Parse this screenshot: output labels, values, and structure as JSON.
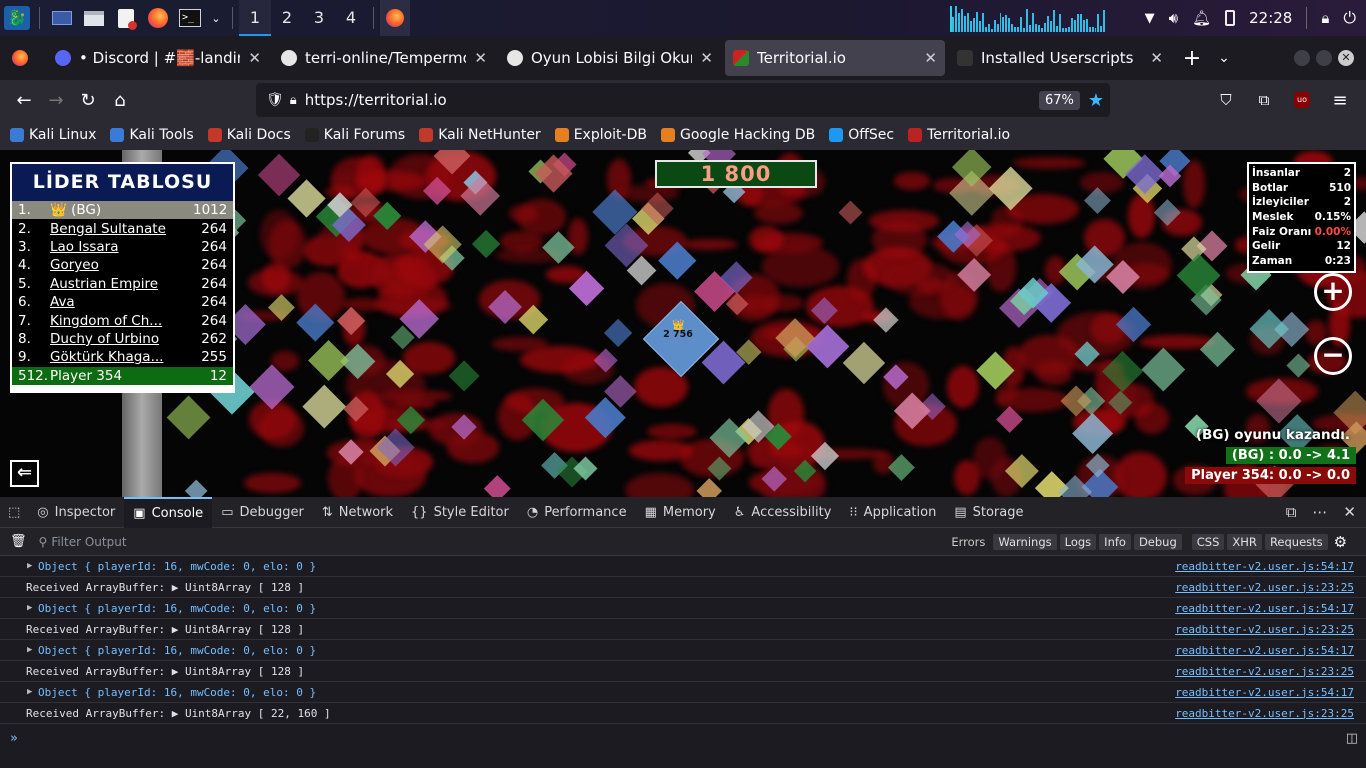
{
  "taskbar": {
    "workspaces": [
      "1",
      "2",
      "3",
      "4"
    ],
    "clock": "22:28"
  },
  "tabs": [
    {
      "title": "• Discord | #🧱-landing-zc",
      "fav": "#5865f2"
    },
    {
      "title": "terri-online/Tempermonk",
      "fav": "#e6e6e6"
    },
    {
      "title": "Oyun Lobisi Bilgi Okuma",
      "fav": "#e6e6e6"
    },
    {
      "title": "Territorial.io",
      "fav": "#b22",
      "active": true
    },
    {
      "title": "Installed Userscripts",
      "fav": "#333"
    }
  ],
  "nav": {
    "url": "https://territorial.io",
    "zoom": "67%"
  },
  "bookmarks": [
    {
      "label": "Kali Linux",
      "c": "#3a7bd5"
    },
    {
      "label": "Kali Tools",
      "c": "#3a7bd5"
    },
    {
      "label": "Kali Docs",
      "c": "#c0392b"
    },
    {
      "label": "Kali Forums",
      "c": "#222"
    },
    {
      "label": "Kali NetHunter",
      "c": "#c0392b"
    },
    {
      "label": "Exploit-DB",
      "c": "#e67e22"
    },
    {
      "label": "Google Hacking DB",
      "c": "#e67e22"
    },
    {
      "label": "OffSec",
      "c": "#1d99f3"
    },
    {
      "label": "Territorial.io",
      "c": "#b22"
    }
  ],
  "game": {
    "leaderboard": {
      "title": "LİDER TABLOSU",
      "rows": [
        {
          "rank": "1.",
          "name": "👑 (BG)",
          "score": "1012"
        },
        {
          "rank": "2.",
          "name": "Bengal Sultanate",
          "score": "264"
        },
        {
          "rank": "3.",
          "name": "Lao Issara",
          "score": "264"
        },
        {
          "rank": "4.",
          "name": "Goryeo",
          "score": "264"
        },
        {
          "rank": "5.",
          "name": "Austrian Empire",
          "score": "264"
        },
        {
          "rank": "6.",
          "name": "Ava",
          "score": "264"
        },
        {
          "rank": "7.",
          "name": "Kingdom of Ch...",
          "score": "264"
        },
        {
          "rank": "8.",
          "name": "Duchy of Urbino",
          "score": "262"
        },
        {
          "rank": "9.",
          "name": "Göktürk Khaga...",
          "score": "255"
        },
        {
          "rank": "512.",
          "name": "Player 354",
          "score": "12"
        }
      ]
    },
    "top_score": "1 800",
    "center_label": "2 756",
    "stats": [
      {
        "k": "İnsanlar",
        "v": "2"
      },
      {
        "k": "Botlar",
        "v": "510"
      },
      {
        "k": "İzleyiciler",
        "v": "2"
      },
      {
        "k": "Meslek",
        "v": "0.15%"
      },
      {
        "k": "Faiz Oranı",
        "v": "0.00%",
        "red": true
      },
      {
        "k": "Gelir",
        "v": "12"
      },
      {
        "k": "Zaman",
        "v": "0:23"
      }
    ],
    "zoom_in": "+",
    "zoom_out": "−",
    "messages": {
      "win": "(BG)  oyunu kazandı.",
      "bg": "(BG) : 0.0 -> 4.1",
      "player": "Player 354: 0.0 -> 0.0"
    }
  },
  "devtools": {
    "tabs": [
      "Inspector",
      "Console",
      "Debugger",
      "Network",
      "Style Editor",
      "Performance",
      "Memory",
      "Accessibility",
      "Application",
      "Storage"
    ],
    "filter_placeholder": "Filter Output",
    "filter_buttons": [
      "Errors",
      "Warnings",
      "Logs",
      "Info",
      "Debug",
      "CSS",
      "XHR",
      "Requests"
    ],
    "logs": [
      {
        "text": "Object { playerId: 16, mwCode: 0, elo: 0 }",
        "src": "readbitter-v2.user.js:54:17",
        "obj": true
      },
      {
        "text": "Received ArrayBuffer: ▶ Uint8Array [ 128 ]",
        "src": "readbitter-v2.user.js:23:25",
        "obj": false
      },
      {
        "text": "Object { playerId: 16, mwCode: 0, elo: 0 }",
        "src": "readbitter-v2.user.js:54:17",
        "obj": true
      },
      {
        "text": "Received ArrayBuffer: ▶ Uint8Array [ 128 ]",
        "src": "readbitter-v2.user.js:23:25",
        "obj": false
      },
      {
        "text": "Object { playerId: 16, mwCode: 0, elo: 0 }",
        "src": "readbitter-v2.user.js:54:17",
        "obj": true
      },
      {
        "text": "Received ArrayBuffer: ▶ Uint8Array [ 128 ]",
        "src": "readbitter-v2.user.js:23:25",
        "obj": false
      },
      {
        "text": "Object { playerId: 16, mwCode: 0, elo: 0 }",
        "src": "readbitter-v2.user.js:54:17",
        "obj": true
      },
      {
        "text": "Received ArrayBuffer: ▶ Uint8Array [ 22, 160 ]",
        "src": "readbitter-v2.user.js:23:25",
        "obj": false
      }
    ],
    "prompt": "»"
  }
}
